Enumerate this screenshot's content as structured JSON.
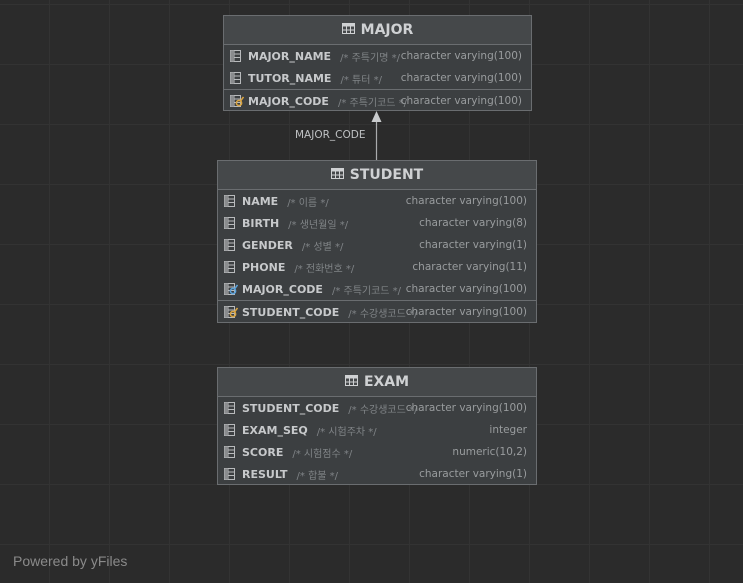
{
  "tables": [
    {
      "name": "MAJOR",
      "columns": [
        {
          "name": "MAJOR_NAME",
          "comment": "/* 주특기명 */",
          "type": "character varying(100)",
          "key": "none"
        },
        {
          "name": "TUTOR_NAME",
          "comment": "/* 튜터 */",
          "type": "character varying(100)",
          "key": "none"
        },
        {
          "name": "MAJOR_CODE",
          "comment": "/* 주특기코드 */",
          "type": "character varying(100)",
          "key": "primary"
        }
      ]
    },
    {
      "name": "STUDENT",
      "columns": [
        {
          "name": "NAME",
          "comment": "/* 이름 */",
          "type": "character varying(100)",
          "key": "none"
        },
        {
          "name": "BIRTH",
          "comment": "/* 생년월일 */",
          "type": "character varying(8)",
          "key": "none"
        },
        {
          "name": "GENDER",
          "comment": "/* 성별 */",
          "type": "character varying(1)",
          "key": "none"
        },
        {
          "name": "PHONE",
          "comment": "/* 전화번호 */",
          "type": "character varying(11)",
          "key": "none"
        },
        {
          "name": "MAJOR_CODE",
          "comment": "/* 주특기코드 */",
          "type": "character varying(100)",
          "key": "foreign"
        },
        {
          "name": "STUDENT_CODE",
          "comment": "/* 수강생코드 */",
          "type": "character varying(100)",
          "key": "primary"
        }
      ]
    },
    {
      "name": "EXAM",
      "columns": [
        {
          "name": "STUDENT_CODE",
          "comment": "/* 수강생코드 */",
          "type": "character varying(100)",
          "key": "none"
        },
        {
          "name": "EXAM_SEQ",
          "comment": "/* 시험주차 */",
          "type": "integer",
          "key": "none"
        },
        {
          "name": "SCORE",
          "comment": "/* 시험점수 */",
          "type": "numeric(10,2)",
          "key": "none"
        },
        {
          "name": "RESULT",
          "comment": "/* 합불 */",
          "type": "character varying(1)",
          "key": "none"
        }
      ]
    }
  ],
  "relation": {
    "label": "MAJOR_CODE"
  },
  "watermark": "Powered by yFiles",
  "colors": {
    "background": "#2b2b2b",
    "entity": "#3c3f41",
    "border": "#6a6d70",
    "key_gold": "#d9a441",
    "key_blue": "#5aa0d8"
  }
}
